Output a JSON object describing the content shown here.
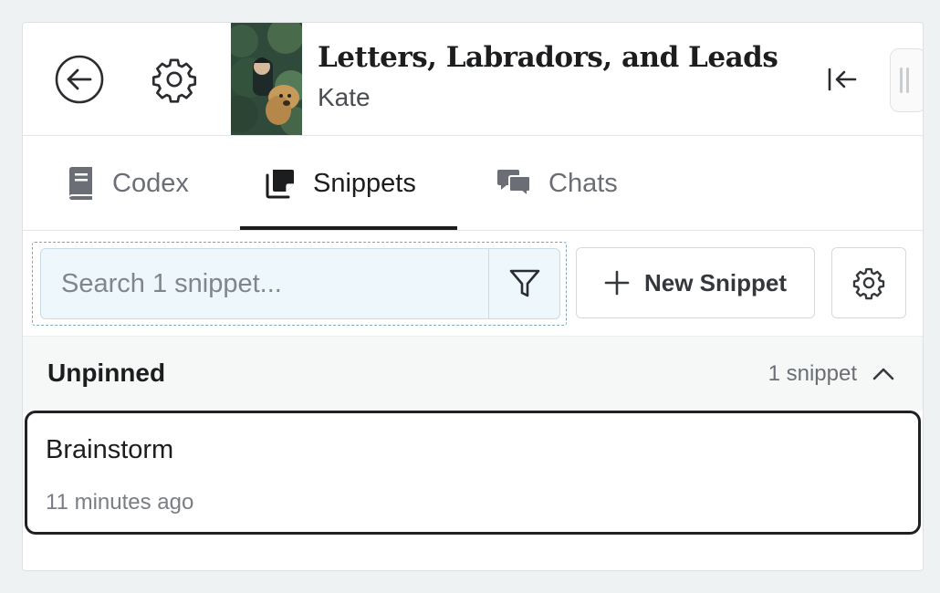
{
  "header": {
    "title": "Letters, Labradors, and Leads",
    "author": "Kate",
    "back_icon": "arrow-left-circle-icon",
    "settings_icon": "gear-icon",
    "collapse_icon": "collapse-left-icon"
  },
  "tabs": [
    {
      "label": "Codex",
      "icon": "book-icon",
      "active": false
    },
    {
      "label": "Snippets",
      "icon": "snippets-icon",
      "active": true
    },
    {
      "label": "Chats",
      "icon": "chat-bubbles-icon",
      "active": false
    }
  ],
  "toolbar": {
    "search_placeholder": "Search 1 snippet...",
    "search_value": "",
    "new_snippet_label": "New Snippet"
  },
  "section": {
    "title": "Unpinned",
    "count": "1 snippet"
  },
  "snippets": [
    {
      "title": "Brainstorm",
      "time": "11 minutes ago"
    }
  ],
  "colors": {
    "accent": "#1c1d1f",
    "search_bg": "#eef8fc",
    "page_bg": "#eef2f2"
  }
}
